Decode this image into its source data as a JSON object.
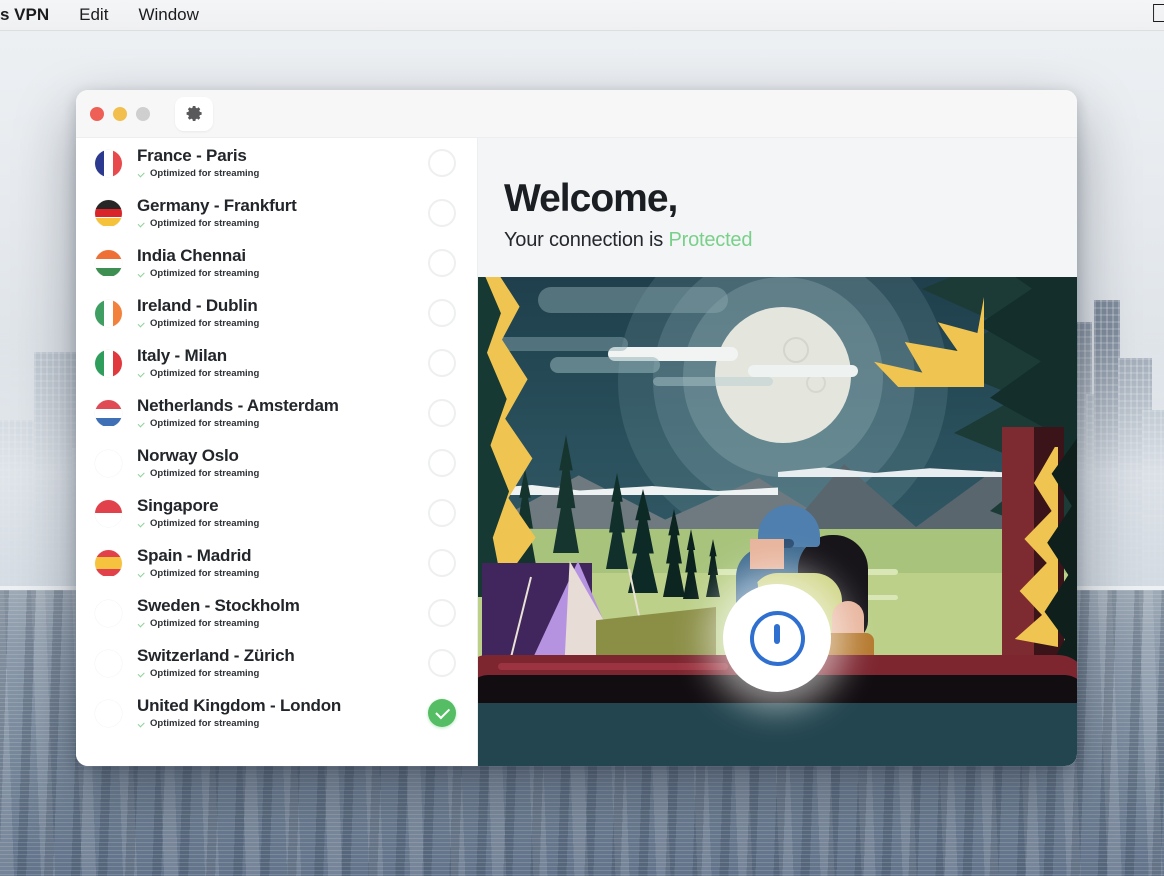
{
  "menubar": {
    "app_name": "s VPN",
    "items": [
      {
        "label": "s VPN",
        "bold": true
      },
      {
        "label": "Edit",
        "bold": false
      },
      {
        "label": "Window",
        "bold": false
      }
    ],
    "status_icon": "apple-logo-icon"
  },
  "window": {
    "traffic_lights": [
      "close-button",
      "minimize-button",
      "zoom-button"
    ],
    "settings_icon": "gear-icon"
  },
  "servers": {
    "subtitle": "Optimized for streaming",
    "items": [
      {
        "name": "France - Paris",
        "sub": "Optimized for streaming",
        "selected": false,
        "flag": "fr"
      },
      {
        "name": "Germany - Frankfurt",
        "sub": "Optimized for streaming",
        "selected": false,
        "flag": "de"
      },
      {
        "name": "India Chennai",
        "sub": "Optimized for streaming",
        "selected": false,
        "flag": "in"
      },
      {
        "name": "Ireland - Dublin",
        "sub": "Optimized for streaming",
        "selected": false,
        "flag": "ie"
      },
      {
        "name": "Italy - Milan",
        "sub": "Optimized for streaming",
        "selected": false,
        "flag": "it"
      },
      {
        "name": "Netherlands - Amsterdam",
        "sub": "Optimized for streaming",
        "selected": false,
        "flag": "nl"
      },
      {
        "name": "Norway Oslo",
        "sub": "Optimized for streaming",
        "selected": false,
        "flag": "no"
      },
      {
        "name": "Singapore",
        "sub": "Optimized for streaming",
        "selected": false,
        "flag": "sg"
      },
      {
        "name": "Spain - Madrid",
        "sub": "Optimized for streaming",
        "selected": false,
        "flag": "es"
      },
      {
        "name": "Sweden - Stockholm",
        "sub": "Optimized for streaming",
        "selected": false,
        "flag": "se"
      },
      {
        "name": "Switzerland - Zürich",
        "sub": "Optimized for streaming",
        "selected": false,
        "flag": "ch"
      },
      {
        "name": "United Kingdom - London",
        "sub": "Optimized for streaming",
        "selected": true,
        "flag": "gb"
      }
    ]
  },
  "hero": {
    "title": "Welcome,",
    "status_prefix": "Your connection is ",
    "status_value": "Protected",
    "power_icon": "power-button-icon"
  },
  "colors": {
    "accent_green": "#55bd63",
    "protected_green": "#79d08a",
    "power_blue": "#2f6fd0",
    "panel_bg": "#f4f5f6",
    "text_dark": "#22262b"
  }
}
